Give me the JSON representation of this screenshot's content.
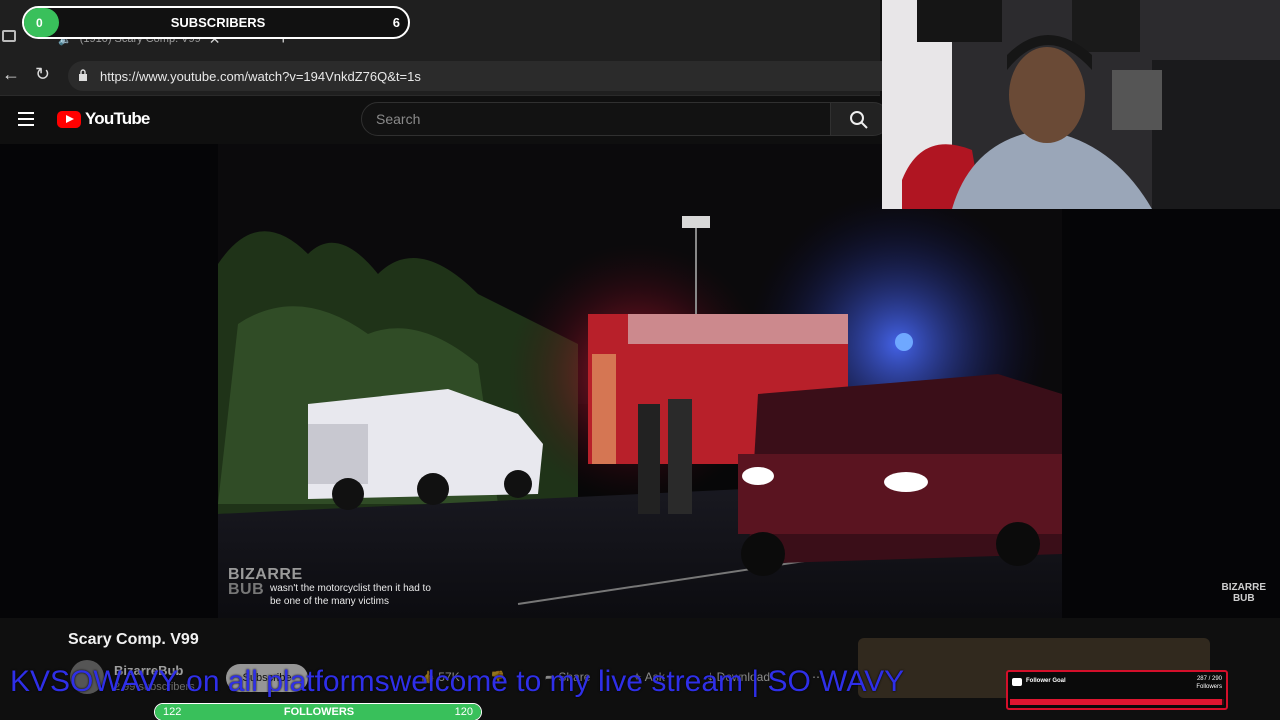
{
  "browser": {
    "tab_title": "(1910) Scary Comp. V99",
    "url": "https://www.youtube.com/watch?v=194VnkdZ76Q&t=1s"
  },
  "youtube": {
    "logo_text": "YouTube",
    "search_placeholder": "Search",
    "video": {
      "title": "Scary Comp. V99",
      "channel": "BizarreBub",
      "subscribers": "2.99 subscribers",
      "subscribe_label": "Subscribe",
      "likes": "57K",
      "share_label": "Share",
      "ask_label": "Ask",
      "download_label": "Download",
      "watermark": [
        "BIZARRE",
        "BUB"
      ],
      "captions": [
        "wasn't the motorcyclist then it had to",
        "be one of the many victims"
      ]
    }
  },
  "overlays": {
    "subscriber_goal": {
      "label": "SUBSCRIBERS",
      "current": "0",
      "target": "6",
      "progress": 0.05
    },
    "follower_bar": {
      "label": "FOLLOWERS",
      "current": "122",
      "target": "120",
      "progress": 1.0
    },
    "follower_goal_widget": {
      "title": "Follower Goal",
      "count": "287 / 290",
      "unit": "Followers",
      "progress": 0.99
    },
    "ticker_text": "KVSOWAVY on all platformswelcome to my live stream | SO WAVY"
  },
  "colors": {
    "accent_green": "#39c05b",
    "yt_red": "#ff0000",
    "ticker_blue": "#2f2fe8",
    "goal_red": "#d40f2a"
  }
}
